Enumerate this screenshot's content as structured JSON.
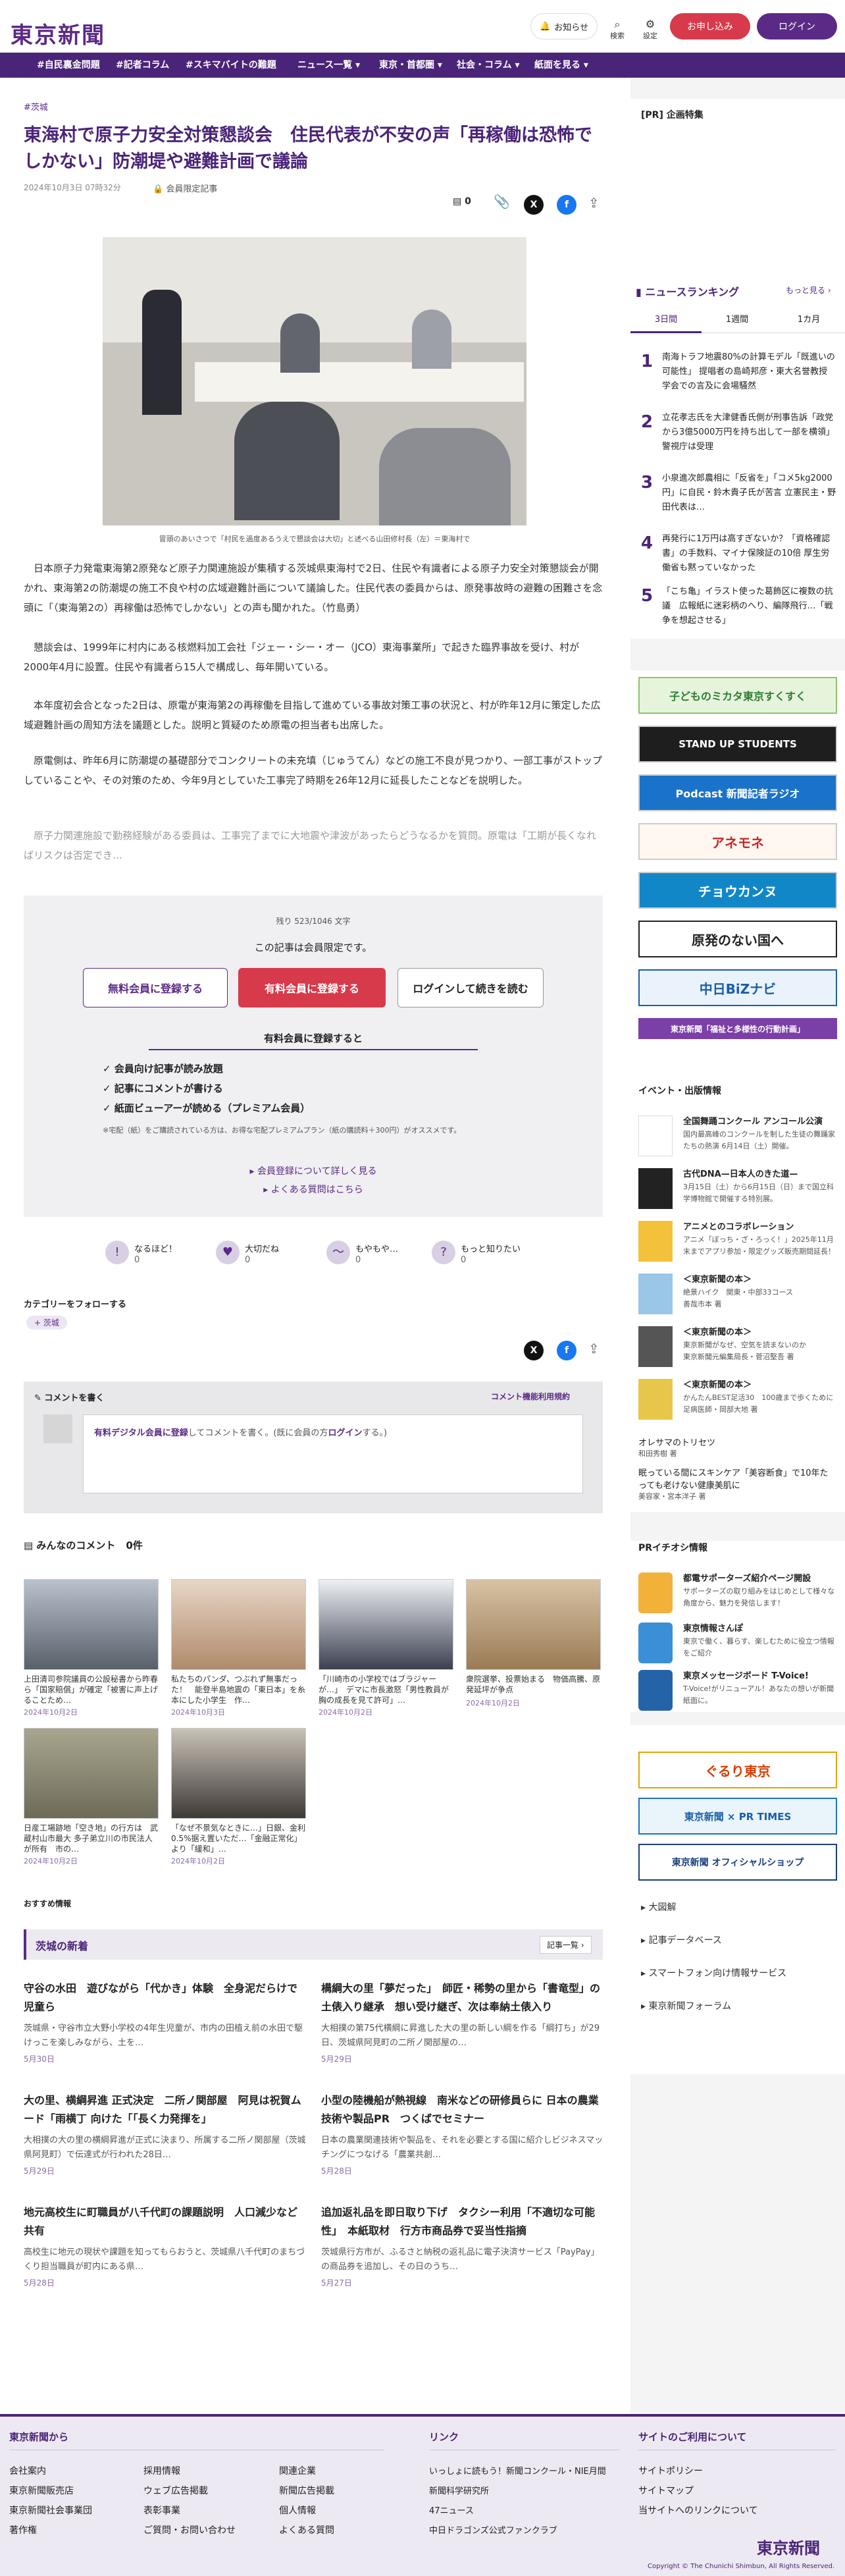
{
  "header": {
    "logo": "東京新聞",
    "notify": "お知らせ",
    "search": "検索",
    "settings": "設定",
    "signup": "お申し込み",
    "login": "ログイン"
  },
  "nav": [
    "#自民裏金問題",
    "#記者コラム",
    "#スキマバイトの難題",
    "ニュース一覧 ▾",
    "東京・首都圏 ▾",
    "社会・コラム ▾",
    "紙面を見る ▾"
  ],
  "article": {
    "category": "#茨城",
    "title": "東海村で原子力安全対策懇談会　住民代表が不安の声「再稼働は恐怖でしかない」防潮堤や避難計画で議論",
    "date": "2024年10月3日 07時32分",
    "members_only": "会員限定記事",
    "comment_count": "0",
    "photo_caption": "冒頭のあいさつで「村民を過度あるうえで懇談会は大切」と述べる山田修村長（左）＝東海村で",
    "paragraphs": [
      "日本原子力発電東海第2原発など原子力関連施設が集積する茨城県東海村で2日、住民や有識者による原子力安全対策懇談会が開かれ、東海第2の防潮堤の施工不良や村の広域避難計画について議論した。住民代表の委員からは、原発事故時の避難の困難さを念頭に「（東海第2の）再稼働は恐怖でしかない」との声も聞かれた。（竹島勇）",
      "懇談会は、1999年に村内にある核燃料加工会社「ジェー・シー・オー（JCO）東海事業所」で起きた臨界事故を受け、村が2000年4月に設置。住民や有識者ら15人で構成し、毎年開いている。",
      "本年度初会合となった2日は、原電が東海第2の再稼働を目指して進めている事故対策工事の状況と、村が昨年12月に策定した広域避難計画の周知方法を議題とした。説明と質疑のため原電の担当者も出席した。",
      "原電側は、昨年6月に防潮堤の基礎部分でコンクリートの未充填（じゅうてん）などの施工不良が見つかり、一部工事がストップしていることや、その対策のため、今年9月としていた工事完了時期を26年12月に延長したことなどを説明した。",
      "原子力関連施設で勤務経験がある委員は、工事完了までに大地震や津波があったらどうなるかを質問。原電は「工期が長くなればリスクは否定でき…"
    ],
    "remaining": "残り 523/1046 文字",
    "members_only_notice": "この記事は会員限定です。",
    "btn_free": "無料会員に登録する",
    "btn_paid": "有料会員に登録する",
    "btn_login": "ログインして続きを読む",
    "benefit_title": "有料会員に登録すると",
    "benefits": [
      "✓ 会員向け記事が読み放題",
      "✓ 記事にコメントが書ける",
      "✓ 紙面ビューアーが読める（プレミアム会員）"
    ],
    "benefit_note": "※宅配（紙）をご購読されている方は、お得な宅配プレミアムプラン（紙の購読料＋300円）がオススメです。",
    "more_link": "会員登録について詳しく見る",
    "faq_link": "よくある質問はこちら",
    "reactions": [
      {
        "label": "なるほど！",
        "count": "0",
        "icon": "!"
      },
      {
        "label": "大切だね",
        "count": "0",
        "icon": "♥"
      },
      {
        "label": "もやもや…",
        "count": "0",
        "icon": "〜"
      },
      {
        "label": "もっと知りたい",
        "count": "0",
        "icon": "?"
      }
    ],
    "follow_label": "カテゴリーをフォローする",
    "follow_tag": "+ 茨城",
    "comment_write": "コメントを書く",
    "comment_terms": "コメント機能利用規約",
    "comment_prompt_a": "有料デジタル会員に登録",
    "comment_prompt_b": "してコメントを書く。(既に会員の方",
    "comment_prompt_c": "ログイン",
    "comment_prompt_d": "する。)",
    "all_comments": "みんなのコメント",
    "all_comments_count": "0件"
  },
  "related": [
    {
      "caption": "上田清司参院議員の公設秘書から昨春ら「国家賠償」が確定「被害に声上げることため…",
      "date": "2024年10月2日"
    },
    {
      "caption": "私たちのパンダ、つぶれず無事だった！　能登半島地震の「東日本」を糸本にした小学生　作…",
      "date": "2024年10月3日"
    },
    {
      "caption": "「川崎市の小学校ではブラジャーが…」　デマに市長激怒「男性教員が胸の成長を見て許可」…",
      "date": "2024年10月2日"
    },
    {
      "caption": "衆院選挙、投票始まる　物価高騰、原発延坪が争点",
      "date": "2024年10月2日"
    },
    {
      "caption": "日産工場跡地「空き地」の行方は　武蔵村山市最大 多子弟立川の市民法人が所有　市の…",
      "date": "2024年10月2日"
    },
    {
      "caption": "「なぜ不景気なときに…」日銀、金利0.5%据え置いただ…「金融正常化」より「緩和」…",
      "date": "2024年10月2日"
    }
  ],
  "recommend_label": "おすすめ情報",
  "local_news": {
    "title": "茨城の新着",
    "more": "記事一覧 ›",
    "items": [
      {
        "title": "守谷の水田　遊びながら「代かき」体験　全身泥だらけで児童ら",
        "body": "茨城県・守谷市立大野小学校の4年生児童が、市内の田植え前の水田で駆けっこを楽しみながら、土を…",
        "date": "5月30日"
      },
      {
        "title": "構綱大の里「夢だった」　師匠・稀勢の里から「書竜型」の土俵入り継承　想い受け継ぎ、次は奉納土俵入り",
        "body": "大相撲の第75代横綱に昇進した大の里の新しい綱を作る「綱打ち」が29日、茨城県阿見町の二所ノ関部屋の…",
        "date": "5月29日"
      },
      {
        "title": "大の里、横綱昇進 正式決定　二所ノ関部屋　阿見は祝賀ムード「雨横丁 向けた「「長く力発揮を」",
        "body": "大相撲の大の里の横綱昇進が正式に決まり、所属する二所ノ関部屋（茨城県阿見町）で伝達式が行われた28日…",
        "date": "5月29日"
      },
      {
        "title": "小型の陸機船が熱視線　南米などの研修員らに 日本の農業技術や製品PR　つくばでセミナー",
        "body": "日本の農業関連技術や製品を、それを必要とする国に紹介しビジネスマッチングにつなげる「農業共創…",
        "date": "5月28日"
      },
      {
        "title": "地元高校生に町職員が八千代町の課題説明　人口減少など共有",
        "body": "高校生に地元の現状や課題を知ってもらおうと、茨城県八千代町のまちづくり担当職員が町内にある県…",
        "date": "5月28日"
      },
      {
        "title": "追加返礼品を即日取り下げ　タクシー利用「不適切な可能性」　本紙取材　行方市商品券で妥当性指摘",
        "body": "茨城県行方市が、ふるさと納税の返礼品に電子決済サービス「PayPay」の商品券を追加し、その日のうち…",
        "date": "5月27日"
      }
    ]
  },
  "sidebar": {
    "ad_label": "[PR] 企画特集",
    "ranking_title": "ニュースランキング",
    "ranking_more": "もっと見る ›",
    "ranking_tabs": [
      "3日間",
      "1週間",
      "1カ月"
    ],
    "ranking": [
      {
        "n": "1",
        "text": "南海トラフ地震80%の計算モデル「既進いの可能性」 提唱者の島崎邦彦・東大名誉教授　学会での言及に会場騒然"
      },
      {
        "n": "2",
        "text": "立花孝志氏を大津健香氏側が刑事告訴「政党から3億5000万円を持ち出して一部を横領」 警視庁は受理"
      },
      {
        "n": "3",
        "text": "小泉進次郎農相に「反省を」「コメ5kg2000円」に自民・鈴木貴子氏が苦言 立憲民主・野田代表は…"
      },
      {
        "n": "4",
        "text": "再発行に1万円は高すぎないか？「資格確認書」の手数料、マイナ保険証の10倍 厚生労働省も黙っていなかった"
      },
      {
        "n": "5",
        "text": "「こち亀」イラスト使った葛飾区に複数の抗議　広報紙に迷彩柄のへり、編隊飛行…「戦争を想起させる」"
      }
    ],
    "banners": [
      "子どものミカタ東京すくすく",
      "STAND UP STUDENTS",
      "Podcast 新聞記者ラジオ",
      "アネモネ",
      "チョウカンヌ",
      "原発のない国へ",
      "中日BiZナビ",
      "東京新聞「福祉と多様性の行動計画」"
    ],
    "events_title": "イベント・出版情報",
    "events": [
      {
        "title": "全国舞踊コンクール アンコール公演",
        "sub": "国内最高峰のコンクールを制した生徒の舞踊家たちの熱演 6月14日（土）開催。"
      },
      {
        "title": "古代DNA—日本人のきた道—",
        "sub": "3月15日（土）から6月15日（日）まで国立科学博物館で開催する特別展。"
      },
      {
        "title": "アニメとのコラボレーション",
        "sub": "アニメ「ぼっち・ざ・ろっく！」2025年11月末までアプリ参加・限定グッズ販売期間延長！"
      },
      {
        "title": "＜東京新聞の本＞",
        "sub": "絶景ハイク　関東・中部33コース\n善哉市本 著"
      },
      {
        "title": "＜東京新聞の本＞",
        "sub": "東京新聞がなぜ、空気を読まないのか\n東京新聞元編集局長・菅沼堅吾 著"
      },
      {
        "title": "＜東京新聞の本＞",
        "sub": "かんたんBEST足活30　100歳まで歩くために\n足病医師・岡部大地 著"
      }
    ],
    "books": [
      {
        "title": "オレサマのトリセツ",
        "sub": "和田秀樹 著"
      },
      {
        "title": "眠っている間にスキンケア「美容断食」で10年たっても老けない健康美肌に",
        "sub": "美容家・宮本洋子 著"
      }
    ],
    "pr_title": "PRイチオシ情報",
    "pr": [
      {
        "title": "都電サポーターズ紹介ページ開設",
        "sub": "サポーターズの取り組みをはじめとして様々な角度から、魅力を発信します！"
      },
      {
        "title": "東京情報さんぽ",
        "sub": "東京で働く、暮らす、楽しむために役立つ情報をご紹介"
      },
      {
        "title": "東京メッセージボード T-Voice!",
        "sub": "T-Voice!がリニューアル！あなたの想いが新聞紙面に。"
      }
    ],
    "bottom_banners": [
      "ぐるり東京",
      "東京新聞 × PR TIMES",
      "東京新聞 オフィシャルショップ"
    ],
    "links": [
      "大図解",
      "記事データベース",
      "スマートフォン向け情報サービス",
      "東京新聞フォーラム"
    ]
  },
  "footer": {
    "col1_title": "東京新聞から",
    "col1": [
      "会社案内",
      "採用情報",
      "関連企業",
      "東京新聞販売店",
      "ウェブ広告掲載",
      "新聞広告掲載",
      "東京新聞社会事業団",
      "表彰事業",
      "個人情報",
      "著作権",
      "ご質問・お問い合わせ",
      "よくある質問"
    ],
    "col2_title": "リンク",
    "col2": [
      "いっしょに読もう！新聞コンクール・NIE月間",
      "新聞科学研究所",
      "47ニュース",
      "中日ドラゴンズ公式ファンクラブ"
    ],
    "col3_title": "サイトのご利用について",
    "col3": [
      "サイトポリシー",
      "サイトマップ",
      "当サイトへのリンクについて"
    ],
    "copyright": "Copyright © The Chunichi Shimbun, All Rights Reserved."
  }
}
